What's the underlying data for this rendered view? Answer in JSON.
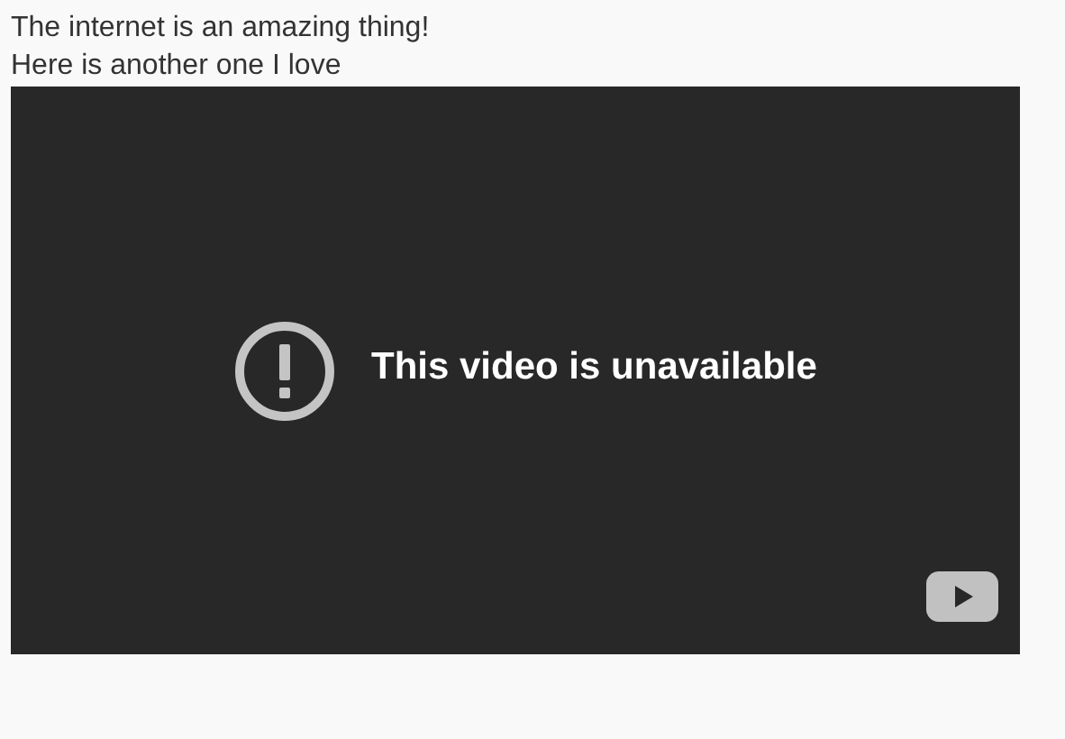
{
  "paragraphs": [
    "The internet is an amazing thing!",
    "Here is another one I love"
  ],
  "video": {
    "message": "This video is unavailable"
  }
}
